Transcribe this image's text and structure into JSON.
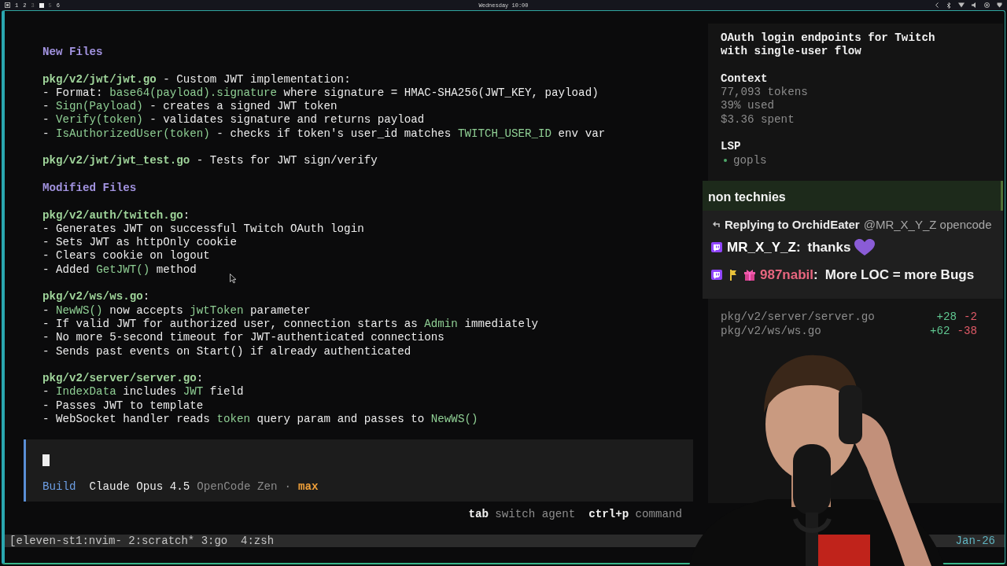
{
  "top_bar": {
    "workspaces": [
      {
        "label": "1",
        "kind": "number",
        "occupied": true
      },
      {
        "label": "2",
        "kind": "number",
        "occupied": true
      },
      {
        "label": "3",
        "kind": "number",
        "occupied": false
      },
      {
        "kind": "current",
        "occupied": true
      },
      {
        "label": "5",
        "kind": "number",
        "occupied": false
      },
      {
        "label": "6",
        "kind": "number",
        "occupied": true
      }
    ],
    "clock": "Wednesday 10:00"
  },
  "summary": {
    "blocks": [
      {
        "lines": [
          [
            {
              "text": "New Files",
              "kind": "heading"
            }
          ]
        ]
      },
      {
        "lines": [
          [
            {
              "text": "pkg/v2/jwt/jwt.go",
              "kind": "path"
            },
            {
              "text": " - Custom JWT implementation:",
              "kind": "plain"
            }
          ],
          [
            {
              "text": "- Format: ",
              "kind": "plain"
            },
            {
              "text": "base64(payload).signature",
              "kind": "code"
            },
            {
              "text": " where signature = HMAC-SHA256(JWT_KEY, payload)",
              "kind": "plain"
            }
          ],
          [
            {
              "text": "- ",
              "kind": "plain"
            },
            {
              "text": "Sign(Payload)",
              "kind": "code"
            },
            {
              "text": " - creates a signed JWT token",
              "kind": "plain"
            }
          ],
          [
            {
              "text": "- ",
              "kind": "plain"
            },
            {
              "text": "Verify(token)",
              "kind": "code"
            },
            {
              "text": " - validates signature and returns payload",
              "kind": "plain"
            }
          ],
          [
            {
              "text": "- ",
              "kind": "plain"
            },
            {
              "text": "IsAuthorizedUser(token)",
              "kind": "code"
            },
            {
              "text": " - checks if token's user_id matches ",
              "kind": "plain"
            },
            {
              "text": "TWITCH_USER_ID",
              "kind": "code"
            },
            {
              "text": " env var",
              "kind": "plain"
            }
          ]
        ]
      },
      {
        "lines": [
          [
            {
              "text": "pkg/v2/jwt/jwt_test.go",
              "kind": "path"
            },
            {
              "text": " - Tests for JWT sign/verify",
              "kind": "plain"
            }
          ]
        ]
      },
      {
        "lines": [
          [
            {
              "text": "Modified Files",
              "kind": "heading"
            }
          ]
        ]
      },
      {
        "lines": [
          [
            {
              "text": "pkg/v2/auth/twitch.go",
              "kind": "path"
            },
            {
              "text": ":",
              "kind": "plain"
            }
          ],
          [
            {
              "text": "- Generates JWT on successful Twitch OAuth login",
              "kind": "plain"
            }
          ],
          [
            {
              "text": "- Sets JWT as httpOnly cookie",
              "kind": "plain"
            }
          ],
          [
            {
              "text": "- Clears cookie on logout",
              "kind": "plain"
            }
          ],
          [
            {
              "text": "- Added ",
              "kind": "plain"
            },
            {
              "text": "GetJWT()",
              "kind": "code"
            },
            {
              "text": " method",
              "kind": "plain"
            }
          ]
        ]
      },
      {
        "lines": [
          [
            {
              "text": "pkg/v2/ws/ws.go",
              "kind": "path"
            },
            {
              "text": ":",
              "kind": "plain"
            }
          ],
          [
            {
              "text": "- ",
              "kind": "plain"
            },
            {
              "text": "NewWS()",
              "kind": "code"
            },
            {
              "text": " now accepts ",
              "kind": "plain"
            },
            {
              "text": "jwtToken",
              "kind": "code"
            },
            {
              "text": " parameter",
              "kind": "plain"
            }
          ],
          [
            {
              "text": "- If valid JWT for authorized user, connection starts as ",
              "kind": "plain"
            },
            {
              "text": "Admin",
              "kind": "code"
            },
            {
              "text": " immediately",
              "kind": "plain"
            }
          ],
          [
            {
              "text": "- No more 5-second timeout for JWT-authenticated connections",
              "kind": "plain"
            }
          ],
          [
            {
              "text": "- Sends past events on Start() if already authenticated",
              "kind": "plain"
            }
          ]
        ]
      },
      {
        "lines": [
          [
            {
              "text": "pkg/v2/server/server.go",
              "kind": "path"
            },
            {
              "text": ":",
              "kind": "plain"
            }
          ],
          [
            {
              "text": "- ",
              "kind": "plain"
            },
            {
              "text": "IndexData",
              "kind": "code"
            },
            {
              "text": " includes ",
              "kind": "plain"
            },
            {
              "text": "JWT",
              "kind": "code"
            },
            {
              "text": " field",
              "kind": "plain"
            }
          ],
          [
            {
              "text": "- Passes JWT to template",
              "kind": "plain"
            }
          ],
          [
            {
              "text": "- WebSocket handler reads ",
              "kind": "plain"
            },
            {
              "text": "token",
              "kind": "code"
            },
            {
              "text": " query param and passes to ",
              "kind": "plain"
            },
            {
              "text": "NewWS()",
              "kind": "code"
            }
          ]
        ]
      }
    ]
  },
  "prompt": {
    "agent": "Build",
    "model": "Claude Opus 4.5",
    "provider": "OpenCode Zen",
    "separator": "·",
    "variant": "max"
  },
  "hints": [
    {
      "key": "tab",
      "action": "switch agent"
    },
    {
      "key": "ctrl+p",
      "action": "command"
    }
  ],
  "sidebar": {
    "title": "OAuth login endpoints for Twitch with single-user flow",
    "context": {
      "heading": "Context",
      "lines": [
        "77,093 tokens",
        "39% used",
        "$3.36 spent"
      ]
    },
    "lsp": {
      "heading": "LSP",
      "servers": [
        {
          "name": "gopls",
          "color": "#4fa86a"
        }
      ]
    },
    "files": [
      {
        "path": "pkg/v2/server/server.go",
        "added": "+28",
        "removed": "-2"
      },
      {
        "path": "pkg/v2/ws/ws.go",
        "added": "+62",
        "removed": "-38"
      }
    ]
  },
  "chat": {
    "messages": [
      {
        "kind": "highlight",
        "text": "non technies"
      },
      {
        "kind": "reply",
        "target": "Replying to OrchidEater",
        "mention": "@MR_X_Y_Z opencode"
      },
      {
        "kind": "message",
        "badges": [
          {
            "kind": "twitch"
          }
        ],
        "user": "MR_X_Y_Z",
        "color": "#ffffff",
        "separator": ":",
        "text": "thanks",
        "emote": {
          "kind": "heart"
        }
      },
      {
        "kind": "message",
        "badges": [
          {
            "kind": "twitch"
          },
          {
            "kind": "flag"
          },
          {
            "kind": "gift"
          }
        ],
        "user": "987nabil",
        "color": "#e8667f",
        "separator": ":",
        "text": "More LOC = more Bugs"
      }
    ]
  },
  "status_bar": {
    "session": "[eleven-st1:nvim- 2:scratch* 3:go  4:zsh",
    "date": "Jan-26"
  }
}
